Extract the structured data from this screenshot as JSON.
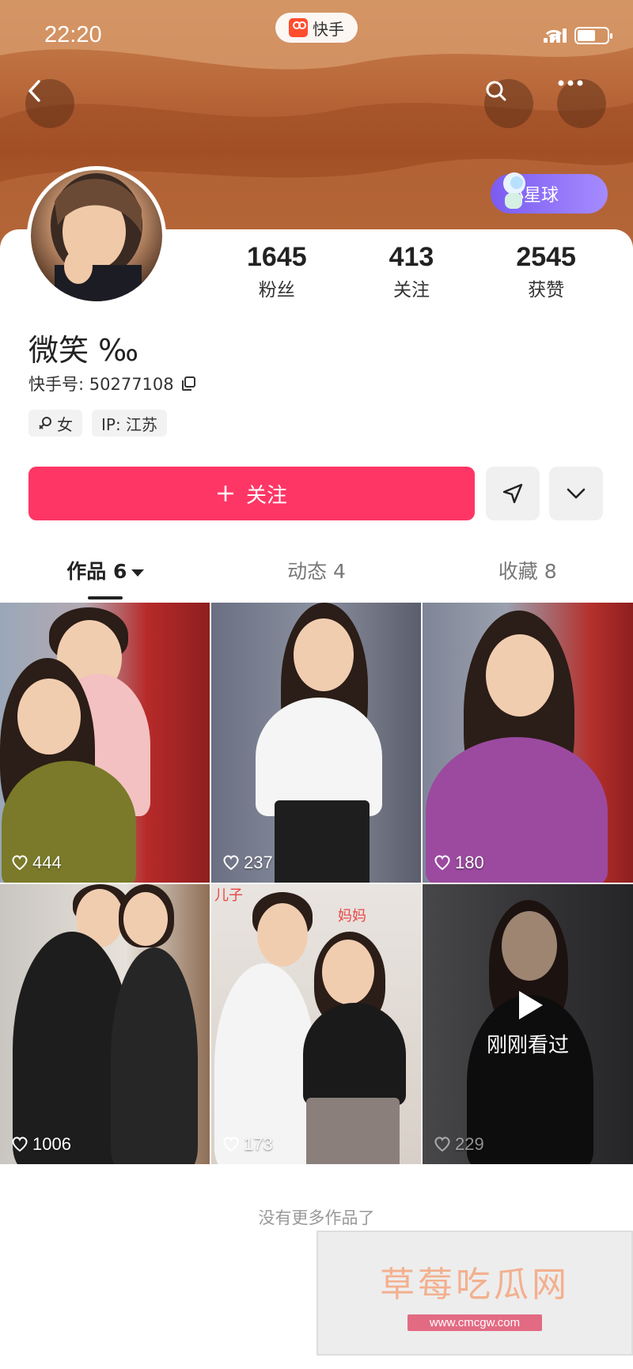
{
  "status_bar": {
    "time": "22:20",
    "app_name": "快手"
  },
  "badge": {
    "label": "小星球"
  },
  "profile": {
    "nickname": "微笑 ‰",
    "kwai_id": "快手号: 50277108",
    "gender_tag": "女",
    "ip_tag": "IP: 江苏"
  },
  "stats": [
    {
      "value": "1645",
      "label": "粉丝"
    },
    {
      "value": "413",
      "label": "关注"
    },
    {
      "value": "2545",
      "label": "获赞"
    }
  ],
  "actions": {
    "follow_label": "关注"
  },
  "tabs": [
    {
      "label": "作品 6"
    },
    {
      "label": "动态 4"
    },
    {
      "label": "收藏 8"
    }
  ],
  "videos": [
    {
      "likes": "444"
    },
    {
      "likes": "237"
    },
    {
      "likes": "180"
    },
    {
      "likes": "1006"
    },
    {
      "likes": "173",
      "overlay_left": "儿子",
      "overlay_right": "妈妈"
    },
    {
      "likes": "229",
      "overlay": "刚刚看过"
    }
  ],
  "footer": {
    "no_more": "没有更多作品了"
  },
  "watermark": {
    "title": "草莓吃瓜网",
    "url": "www.cmcgw.com"
  },
  "colors": {
    "accent": "#fe3666",
    "badge": "#7b5cf0"
  }
}
